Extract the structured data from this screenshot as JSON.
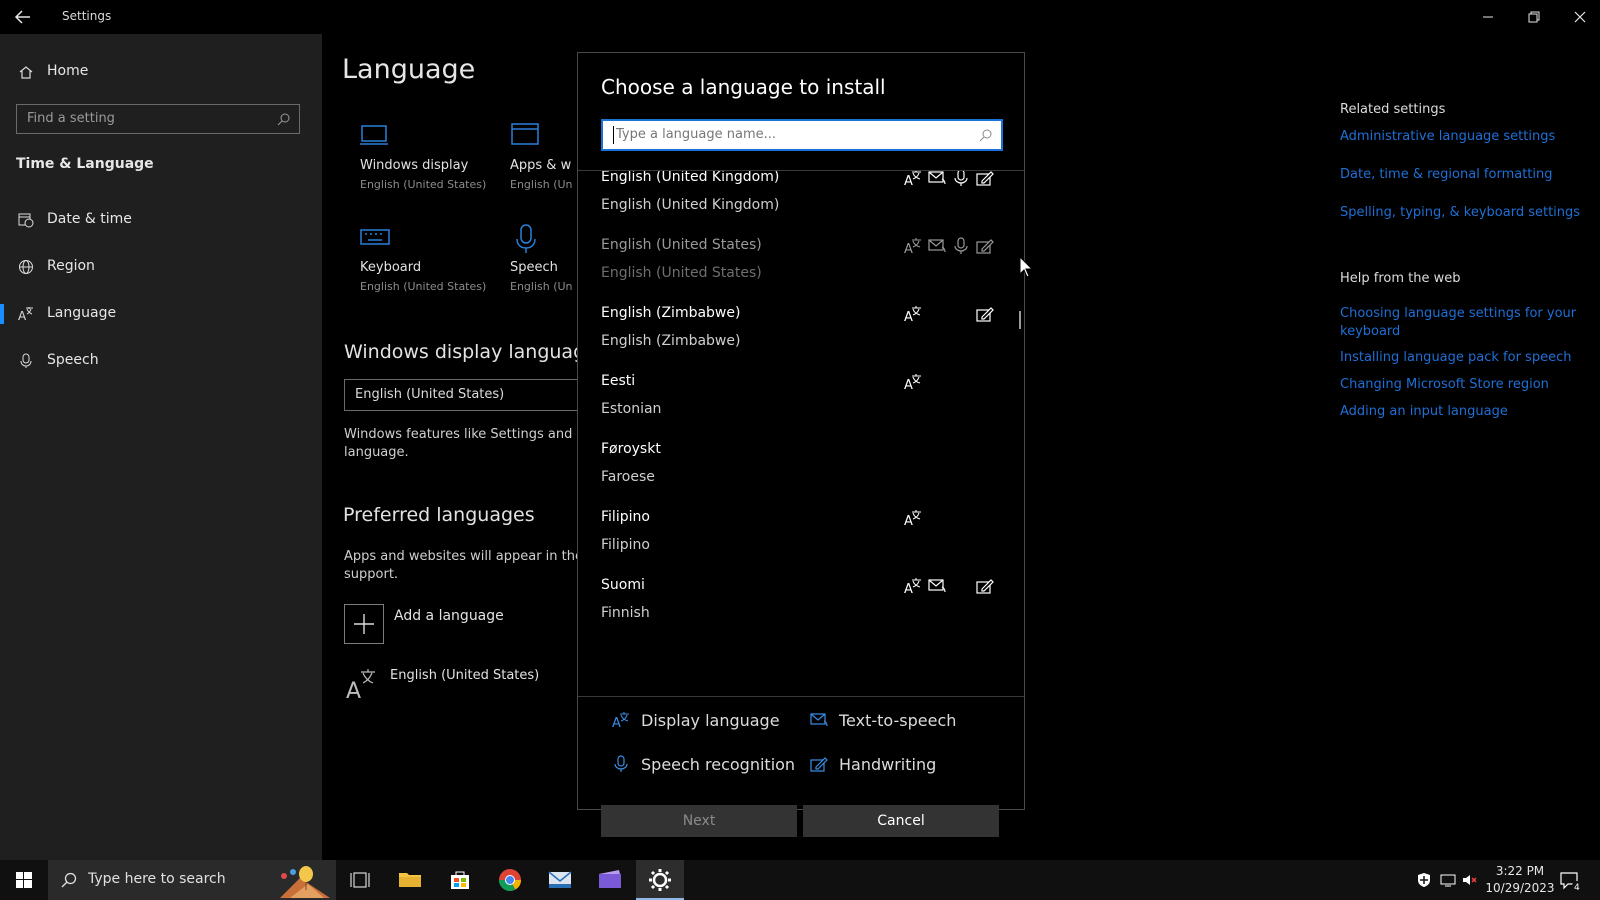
{
  "window": {
    "title": "Settings"
  },
  "sidebar": {
    "home_label": "Home",
    "search_placeholder": "Find a setting",
    "section_title": "Time & Language",
    "items": [
      {
        "label": "Date & time",
        "icon": "clock-calendar-icon"
      },
      {
        "label": "Region",
        "icon": "globe-icon"
      },
      {
        "label": "Language",
        "icon": "language-icon",
        "active": true
      },
      {
        "label": "Speech",
        "icon": "microphone-icon"
      }
    ]
  },
  "main": {
    "title": "Language",
    "tiles": [
      {
        "name": "Windows display",
        "sub": "English (United States)",
        "icon": "monitor-icon"
      },
      {
        "name": "Apps & we",
        "sub": "English (Uni",
        "icon": "window-icon"
      },
      {
        "name": "Keyboard",
        "sub": "English (United States)",
        "icon": "keyboard-icon"
      },
      {
        "name": "Speech",
        "sub": "English (Uni",
        "icon": "microphone-icon"
      }
    ],
    "display_language_heading": "Windows display language",
    "display_language_value": "English (United States)",
    "display_language_desc_1": "Windows features like Settings and Fil",
    "display_language_desc_2": "language.",
    "preferred_heading": "Preferred languages",
    "preferred_desc_1": "Apps and websites will appear in the f",
    "preferred_desc_2": "support.",
    "add_language_label": "Add a language",
    "preferred_language": "English (United States)"
  },
  "related": {
    "title": "Related settings",
    "links": [
      "Administrative language settings",
      "Date, time & regional formatting",
      "Spelling, typing, & keyboard settings"
    ],
    "help_title": "Help from the web",
    "help_links_1a": "Choosing language settings for your",
    "help_links_1b": "keyboard",
    "help_links": [
      "Installing language pack for speech",
      "Changing Microsoft Store region",
      "Adding an input language"
    ]
  },
  "dialog": {
    "title": "Choose a language to install",
    "search_placeholder": "Type a language name...",
    "languages": [
      {
        "native": "English (United Kingdom)",
        "english": "English (United Kingdom)",
        "features": [
          "display",
          "tts",
          "speech",
          "handwriting"
        ]
      },
      {
        "native": "English (United States)",
        "english": "English (United States)",
        "features": [
          "display",
          "tts",
          "speech",
          "handwriting"
        ],
        "installed": true
      },
      {
        "native": "English (Zimbabwe)",
        "english": "English (Zimbabwe)",
        "features": [
          "display",
          "handwriting"
        ]
      },
      {
        "native": "Eesti",
        "english": "Estonian",
        "features": [
          "display"
        ]
      },
      {
        "native": "Føroyskt",
        "english": "Faroese",
        "features": []
      },
      {
        "native": "Filipino",
        "english": "Filipino",
        "features": [
          "display"
        ]
      },
      {
        "native": "Suomi",
        "english": "Finnish",
        "features": [
          "display",
          "tts",
          "handwriting"
        ]
      }
    ],
    "legend": {
      "display": "Display language",
      "tts": "Text-to-speech",
      "speech": "Speech recognition",
      "handwriting": "Handwriting"
    },
    "next_label": "Next",
    "cancel_label": "Cancel"
  },
  "taskbar": {
    "search_placeholder": "Type here to search",
    "time": "3:22 PM",
    "date": "10/29/2023",
    "notification_count": "4"
  },
  "colors": {
    "accent": "#1a8fff",
    "link": "#1f6fd6",
    "sidebar_bg": "#1f1f1f"
  }
}
